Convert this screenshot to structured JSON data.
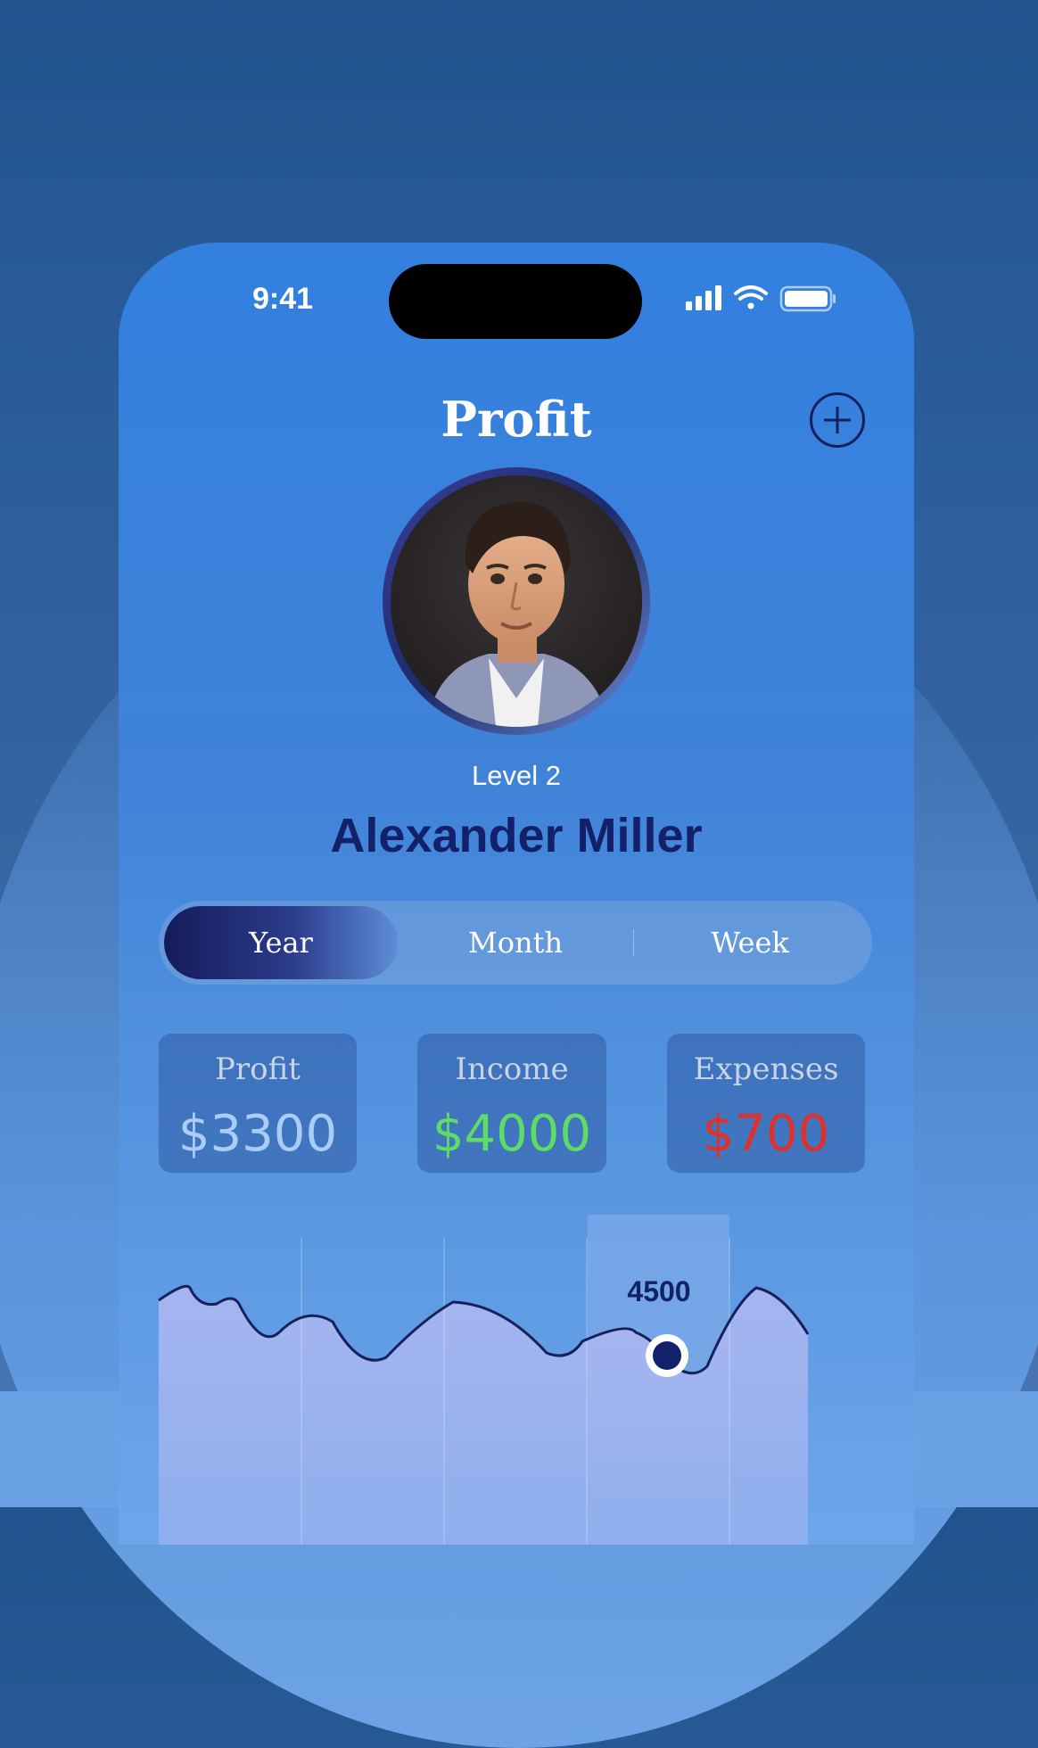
{
  "status_bar": {
    "time": "9:41"
  },
  "header": {
    "title": "Profit"
  },
  "profile": {
    "level": "Level 2",
    "name": "Alexander Miller"
  },
  "period_tabs": {
    "items": [
      "Year",
      "Month",
      "Week"
    ],
    "selected": "Year"
  },
  "stats": [
    {
      "label": "Profit",
      "value": "$3300",
      "color": "#a9cdf6"
    },
    {
      "label": "Income",
      "value": "$4000",
      "color": "#5fdc66"
    },
    {
      "label": "Expenses",
      "value": "$700",
      "color": "#e0302c"
    }
  ],
  "colors": {
    "accent_dark": "#13206a",
    "line": "#17205c"
  },
  "chart_data": {
    "type": "area",
    "highlight_label": "4500",
    "highlight_index": 4
  }
}
